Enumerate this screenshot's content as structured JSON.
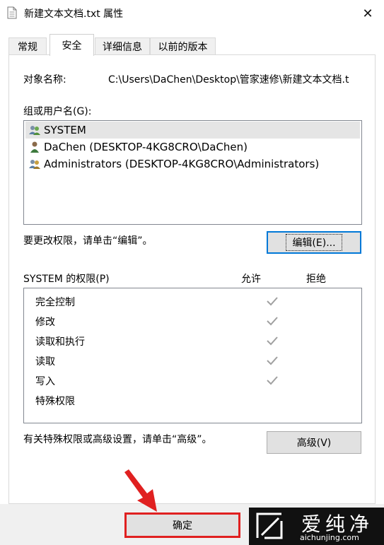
{
  "window": {
    "title": "新建文本文档.txt 属性",
    "close_glyph": "✕"
  },
  "tabs": [
    {
      "label": "常规"
    },
    {
      "label": "安全"
    },
    {
      "label": "详细信息"
    },
    {
      "label": "以前的版本"
    }
  ],
  "object": {
    "label": "对象名称:",
    "path": "C:\\Users\\DaChen\\Desktop\\管家速修\\新建文本文档.t"
  },
  "groups": {
    "label": "组或用户名(G):",
    "items": [
      {
        "name": "SYSTEM",
        "icon": "user-group-icon",
        "selected": true
      },
      {
        "name": "DaChen (DESKTOP-4KG8CRO\\DaChen)",
        "icon": "user-icon",
        "selected": false
      },
      {
        "name": "Administrators (DESKTOP-4KG8CRO\\Administrators)",
        "icon": "user-group-icon",
        "selected": false
      }
    ]
  },
  "edit": {
    "hint": "要更改权限，请单击“编辑”。",
    "button": "编辑(E)..."
  },
  "permissions": {
    "label": "SYSTEM 的权限(P)",
    "allow_header": "允许",
    "deny_header": "拒绝",
    "rows": [
      {
        "name": "完全控制",
        "allow": true
      },
      {
        "name": "修改",
        "allow": true
      },
      {
        "name": "读取和执行",
        "allow": true
      },
      {
        "name": "读取",
        "allow": true
      },
      {
        "name": "写入",
        "allow": true
      },
      {
        "name": "特殊权限",
        "allow": false
      }
    ]
  },
  "advanced": {
    "hint": "有关特殊权限或高级设置，请单击“高级”。",
    "button": "高级(V)"
  },
  "footer": {
    "ok_button": "确定"
  },
  "watermark": {
    "brand": "爱纯净",
    "url": "aichunjing.com"
  },
  "colors": {
    "focus_border": "#0078d7",
    "highlight_red": "#e02020",
    "check_gray": "#a0a0a0"
  }
}
